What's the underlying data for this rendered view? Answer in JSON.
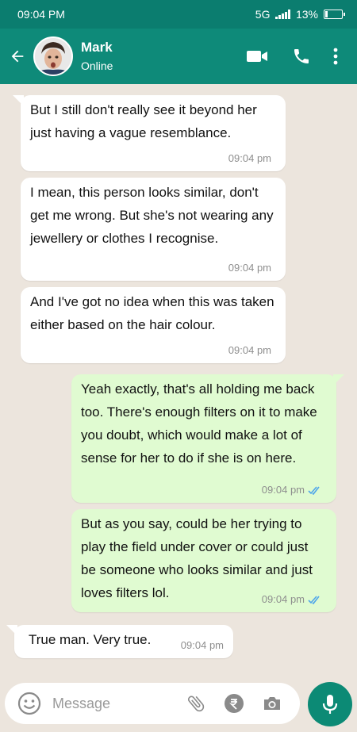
{
  "status_bar": {
    "time": "09:04 PM",
    "network": "5G",
    "battery": "13%",
    "battery_level": 0.13
  },
  "header": {
    "contact_name": "Mark",
    "contact_status": "Online",
    "icons": [
      "back-arrow-icon",
      "video-call-icon",
      "phone-icon",
      "more-vert-icon"
    ]
  },
  "messages": [
    {
      "direction": "in",
      "text": "But I still don't really see it beyond her just having a vague resemblance.",
      "time": "09:04 pm"
    },
    {
      "direction": "in",
      "text": "I mean, this person looks similar, don't get me wrong. But she's not wearing any jewellery or clothes I recognise.",
      "time": "09:04 pm"
    },
    {
      "direction": "in",
      "text": "And I've got no idea when this was taken either based on the hair colour.",
      "time": "09:04 pm"
    },
    {
      "direction": "out",
      "text": "Yeah exactly, that's all holding me back too. There's enough filters on it to make you doubt, which would make a lot of sense for her to do if she is on here.",
      "time": "09:04 pm",
      "read": true
    },
    {
      "direction": "out",
      "text": "But as you say, could be her trying to play the field under cover or could just be someone who looks similar and just loves filters lol.",
      "time": "09:04 pm",
      "read": true
    },
    {
      "direction": "in",
      "text": "True man. Very true.",
      "time": "09:04 pm"
    }
  ],
  "input_bar": {
    "placeholder": "Message",
    "icons": [
      "emoji-icon",
      "attach-icon",
      "rupee-payment-icon",
      "camera-icon",
      "mic-icon"
    ]
  },
  "colors": {
    "header": "#0e8a79",
    "status_bar": "#0b7d6f",
    "incoming_bubble": "#ffffff",
    "outgoing_bubble": "#e0fbd1",
    "read_tick": "#4fa6ea",
    "background": "#ece5dd"
  }
}
